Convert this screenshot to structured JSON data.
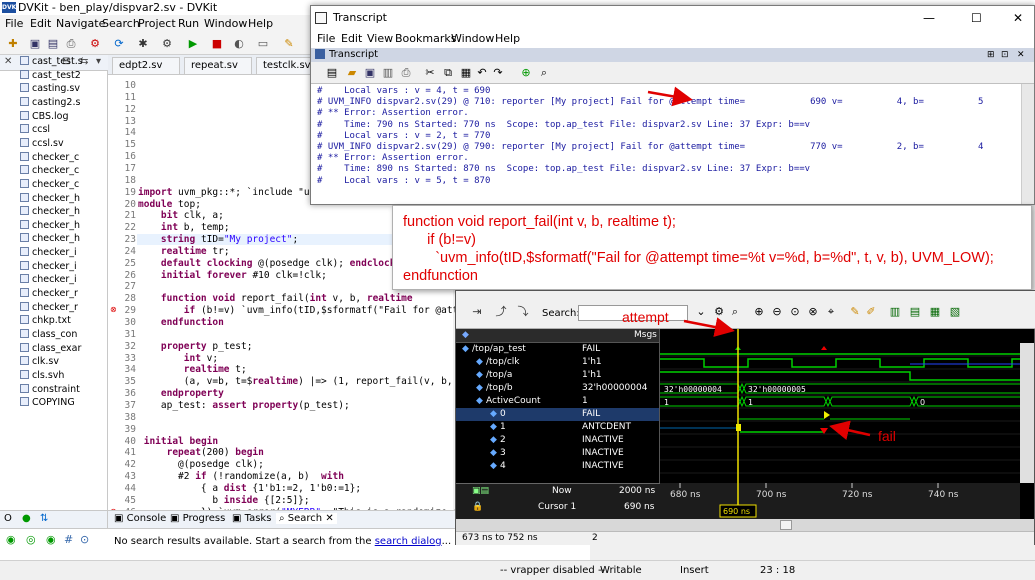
{
  "window": {
    "title": "DVKit - ben_play/dispvar2.sv - DVKit",
    "logo": "DVK"
  },
  "menu": [
    "File",
    "Edit",
    "Navigate",
    "Search",
    "Project",
    "Run",
    "Window",
    "Help"
  ],
  "explorer": {
    "items": [
      "cast_test.s",
      "cast_test2",
      "casting.sv",
      "casting2.s",
      "CBS.log",
      "ccsl",
      "ccsl.sv",
      "checker_c",
      "checker_c",
      "checker_c",
      "checker_h",
      "checker_h",
      "checker_h",
      "checker_h",
      "checker_i",
      "checker_i",
      "checker_i",
      "checker_r",
      "checker_r",
      "chkp.txt",
      "class_con",
      "class_exar",
      "clk.sv",
      "cls.svh",
      "constraint",
      "COPYING"
    ]
  },
  "editor": {
    "tabs": [
      "edpt2.sv",
      "repeat.sv",
      "testclk.sv"
    ],
    "lines": [
      {
        "n": "10",
        "t": ""
      },
      {
        "n": "11",
        "t": ""
      },
      {
        "n": "12",
        "t": ""
      },
      {
        "n": "13",
        "t": ""
      },
      {
        "n": "14",
        "t": ""
      },
      {
        "n": "15",
        "t": ""
      },
      {
        "n": "16",
        "t": ""
      },
      {
        "n": "17",
        "t": ""
      },
      {
        "n": "18",
        "t": ""
      },
      {
        "n": "19",
        "t": "import uvm_pkg::*; `include \"uvm_"
      },
      {
        "n": "20",
        "t": "module top;"
      },
      {
        "n": "21",
        "t": "    bit clk, a;"
      },
      {
        "n": "22",
        "t": "    int b, temp;"
      },
      {
        "n": "23",
        "t": "    string tID=\"My project\";"
      },
      {
        "n": "24",
        "t": "    realtime tr;"
      },
      {
        "n": "25",
        "t": "    default clocking @(posedge clk); endclocking"
      },
      {
        "n": "26",
        "t": "    initial forever #10 clk=!clk;"
      },
      {
        "n": "27",
        "t": ""
      },
      {
        "n": "28",
        "t": "    function void report_fail(int v, b, realtime"
      },
      {
        "n": "29",
        "t": "        if (b!=v) `uvm_info(tID,$sformatf(\"Fail for @attempt"
      },
      {
        "n": "30",
        "t": "    endfunction"
      },
      {
        "n": "31",
        "t": ""
      },
      {
        "n": "32",
        "t": "    property p_test;"
      },
      {
        "n": "33",
        "t": "        int v;"
      },
      {
        "n": "34",
        "t": "        realtime t;"
      },
      {
        "n": "35",
        "t": "        (a, v=b, t=$realtime) |=> (1, report_fail(v, b, t))"
      },
      {
        "n": "36",
        "t": "    endproperty"
      },
      {
        "n": "37",
        "t": "    ap_test: assert property(p_test);"
      },
      {
        "n": "38",
        "t": ""
      },
      {
        "n": "39",
        "t": ""
      },
      {
        "n": "40",
        "t": " initial begin"
      },
      {
        "n": "41",
        "t": "     repeat(200) begin"
      },
      {
        "n": "42",
        "t": "       @(posedge clk);"
      },
      {
        "n": "43",
        "t": "       #2 if (!randomize(a, b)  with"
      },
      {
        "n": "44",
        "t": "           { a dist {1'b1:=2, 1'b0:=1};"
      },
      {
        "n": "45",
        "t": "             b inside {[2:5]};"
      },
      {
        "n": "46",
        "t": "           }) `uvm_error(\"MYERR\", \"This is a randomize error"
      }
    ]
  },
  "bottom": {
    "left_tab": "O",
    "tabs": [
      "Console",
      "Progress",
      "Tasks",
      "Search"
    ],
    "message": "No search results available. Start a search from the ",
    "link": "search dialog",
    "suffix": "..."
  },
  "status": {
    "vrapper": "-- vrapper disabled --",
    "mode": "Writable",
    "insert": "Insert",
    "pos": "23 : 18"
  },
  "transcript": {
    "title": "Transcript",
    "menu": [
      "File",
      "Edit",
      "View",
      "Bookmarks",
      "Window",
      "Help"
    ],
    "sub": "Transcript",
    "lines": [
      "#    Local vars : v = 4, t = 690",
      "# UVM_INFO dispvar2.sv(29) @ 710: reporter [My project] Fail for @attempt time=            690 v=          4, b=          5",
      "# ** Error: Assertion error.",
      "#    Time: 790 ns Started: 770 ns  Scope: top.ap_test File: dispvar2.sv Line: 37 Expr: b==v",
      "#    Local vars : v = 2, t = 770",
      "# UVM_INFO dispvar2.sv(29) @ 790: reporter [My project] Fail for @attempt time=            770 v=          2, b=          4",
      "# ** Error: Assertion error.",
      "#    Time: 890 ns Started: 870 ns  Scope: top.ap_test File: dispvar2.sv Line: 37 Expr: b==v",
      "#    Local vars : v = 5, t = 870"
    ]
  },
  "callout": {
    "lines": [
      "function void report_fail(int v, b, realtime t);",
      "      if (b!=v)",
      "        `uvm_info(tID,$sformatf(\"Fail for @attempt time=%t v=%d, b=%d\", t, v, b), UVM_LOW);",
      "endfunction"
    ]
  },
  "wave": {
    "search_label": "Search:",
    "msgs_header": "Msgs",
    "signals": [
      {
        "name": "/top/ap_test",
        "msg": "FAIL"
      },
      {
        "name": "/top/clk",
        "msg": "1'h1"
      },
      {
        "name": "/top/a",
        "msg": "1'h1"
      },
      {
        "name": "/top/b",
        "msg": "32'h00000004"
      },
      {
        "name": "ActiveCount",
        "msg": "1"
      },
      {
        "name": "0",
        "msg": "FAIL"
      },
      {
        "name": "1",
        "msg": "ANTCDENT"
      },
      {
        "name": "2",
        "msg": "INACTIVE"
      },
      {
        "name": "3",
        "msg": "INACTIVE"
      },
      {
        "name": "4",
        "msg": "INACTIVE"
      }
    ],
    "b_values": [
      "32'h00000004",
      "32'h00000005"
    ],
    "count_values": [
      "1",
      "1",
      "0"
    ],
    "now_label": "Now",
    "now_value": "2000 ns",
    "cursor_label": "Cursor 1",
    "cursor_value": "690 ns",
    "cursor_tag": "690 ns",
    "time_ticks": [
      "680 ns",
      "700 ns",
      "720 ns",
      "740 ns"
    ],
    "range": "673 ns to 752 ns",
    "range_count": "2"
  },
  "annotations": {
    "attempt": "attempt",
    "fail": "fail"
  },
  "colors": {
    "annot": "#e00000",
    "wave_green": "#00d000",
    "cursor": "#f0e000",
    "keyword": "#7f0055",
    "string": "#2a00ff"
  }
}
